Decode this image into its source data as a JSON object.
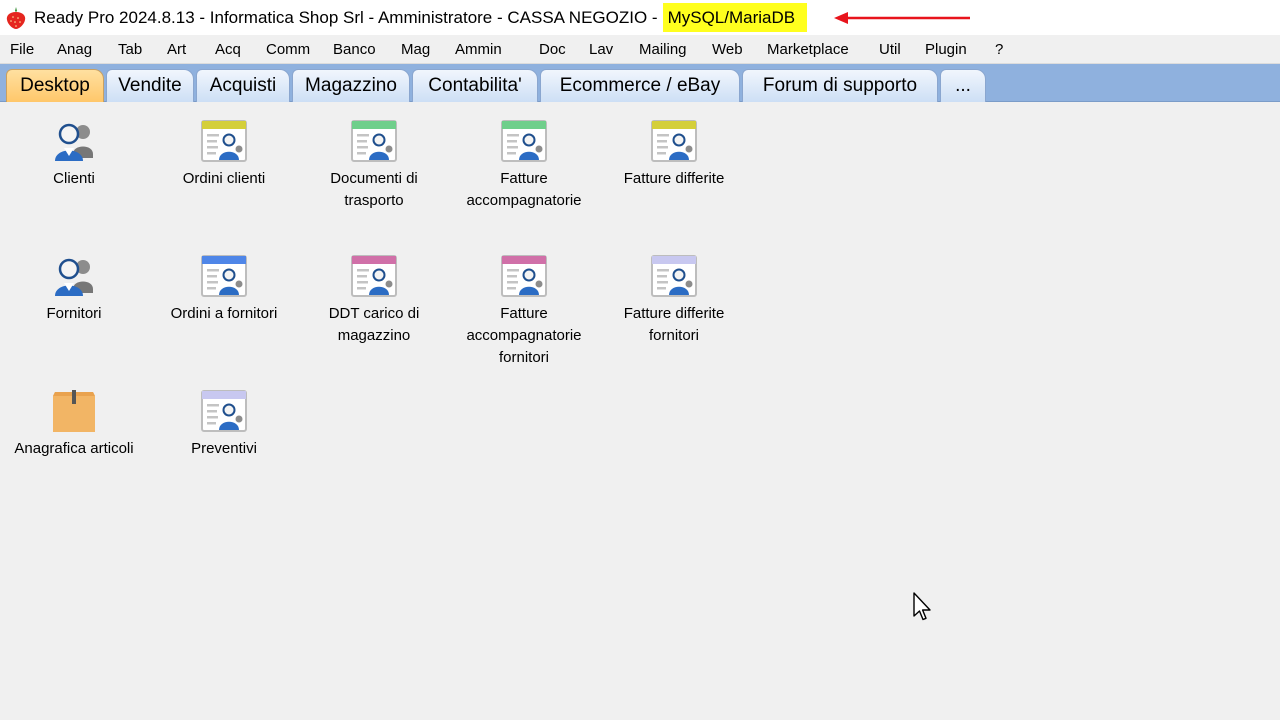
{
  "window": {
    "title": "Ready Pro 2024.8.13 - Informatica Shop Srl - Amministratore - CASSA NEGOZIO -",
    "db_label": "MySQL/MariaDB",
    "app_icon": "strawberry-icon",
    "highlight_color": "#ffff1e",
    "arrow_color": "#e8141c"
  },
  "menu": {
    "items": [
      "File",
      "Anag",
      "Tab",
      "Art",
      "Acq",
      "Comm",
      "Banco",
      "Mag",
      "Ammin",
      "Doc",
      "Lav",
      "Mailing",
      "Web",
      "Marketplace",
      "Util",
      "Plugin",
      "?"
    ]
  },
  "tabs": {
    "items": [
      "Desktop",
      "Vendite",
      "Acquisti",
      "Magazzino",
      "Contabilita'",
      "Ecommerce / eBay",
      "Forum di supporto",
      "..."
    ],
    "active": "Desktop",
    "strip_color": "#8fb1de",
    "active_color": "#ffc76a"
  },
  "desktop": {
    "icons": [
      {
        "label": "Clienti",
        "icon": "customer-icon"
      },
      {
        "label": "Ordini clienti",
        "icon": "document-icon",
        "color": "#d4cf3a"
      },
      {
        "label": "Documenti di trasporto",
        "icon": "document-icon",
        "color": "#6fcf8b"
      },
      {
        "label": "Fatture accompagnatorie",
        "icon": "document-icon",
        "color": "#6fcf8b"
      },
      {
        "label": "Fatture differite",
        "icon": "document-icon",
        "color": "#d4cf3a"
      },
      {
        "label": "Fornitori",
        "icon": "supplier-icon"
      },
      {
        "label": "Ordini a fornitori",
        "icon": "document-icon",
        "color": "#4f86e8"
      },
      {
        "label": "DDT carico di magazzino",
        "icon": "document-icon",
        "color": "#d070a8"
      },
      {
        "label": "Fatture accompagnatorie fornitori",
        "icon": "document-icon",
        "color": "#d070a8"
      },
      {
        "label": "Fatture differite fornitori",
        "icon": "document-icon",
        "color": "#c8c8f0"
      },
      {
        "label": "Anagrafica articoli",
        "icon": "box-icon"
      },
      {
        "label": "Preventivi",
        "icon": "document-icon",
        "color": "#c8c8f0"
      }
    ]
  }
}
